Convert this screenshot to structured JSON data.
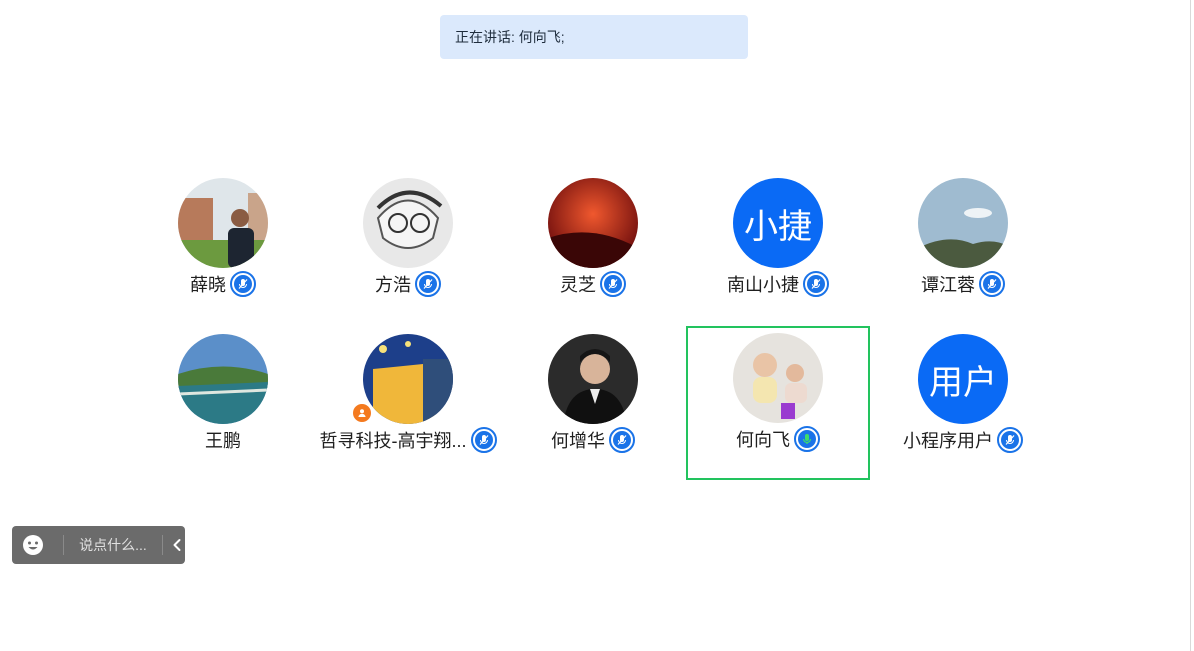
{
  "speaking_banner": {
    "label": "正在讲话: ",
    "speakers": "何向飞;"
  },
  "participants": [
    {
      "name": "薛晓",
      "avatar": "photo",
      "mic": "muted"
    },
    {
      "name": "方浩",
      "avatar": "photo",
      "mic": "muted"
    },
    {
      "name": "灵芝",
      "avatar": "photo",
      "mic": "muted"
    },
    {
      "name": "南山小捷",
      "avatar_text": "小捷",
      "mic": "muted"
    },
    {
      "name": "谭江蓉",
      "avatar": "photo",
      "mic": "muted"
    },
    {
      "name": "王鹏",
      "avatar": "photo",
      "mic": "none"
    },
    {
      "name": "哲寻科技-高宇翔...",
      "avatar": "photo",
      "mic": "muted",
      "badge": "user-icon"
    },
    {
      "name": "何增华",
      "avatar": "photo",
      "mic": "muted"
    },
    {
      "name": "何向飞",
      "avatar": "photo",
      "mic": "speaking",
      "active": true
    },
    {
      "name": "小程序用户",
      "avatar_text": "用户",
      "mic": "muted"
    }
  ],
  "chat_bar": {
    "placeholder": "说点什么...",
    "emoji_icon": "smiley-icon",
    "collapse_icon": "chevron-left-icon"
  },
  "colors": {
    "banner_bg": "#dbe9fc",
    "avatar_blue": "#0a6af5",
    "mic_blue": "#1a73e8",
    "speaking_green": "#22c35e",
    "active_border": "#22c35e",
    "chat_bar_bg": "#6b6b6b"
  }
}
